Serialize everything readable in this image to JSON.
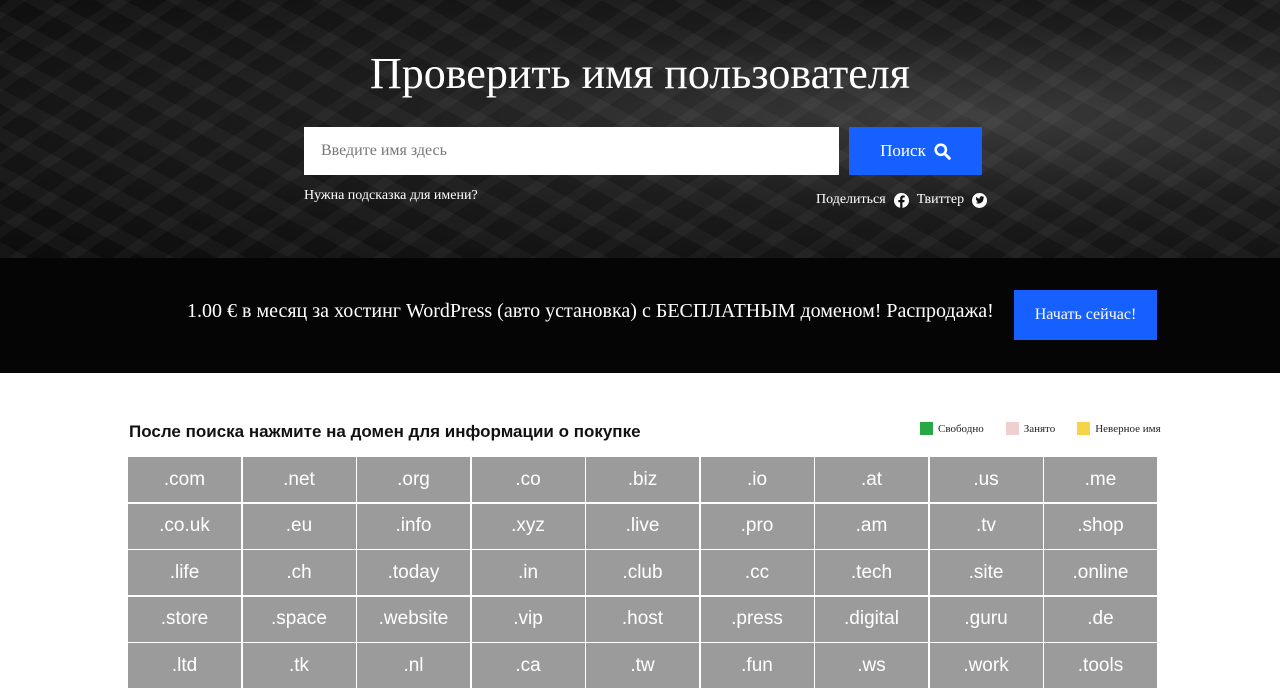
{
  "hero": {
    "title": "Проверить имя пользователя",
    "search_placeholder": "Введите имя здесь",
    "search_button": "Поиск",
    "hint_link": "Нужна подсказка для имени?",
    "share_label": "Поделиться",
    "twitter_label": "Твиттер"
  },
  "promo": {
    "text": "1.00 € в месяц за хостинг WordPress (авто установка) с БЕСПЛАТНЫМ доменом! Распродажа!",
    "button": "Начать сейчас!"
  },
  "results": {
    "heading": "После поиска нажмите на домен для информации о покупке",
    "legend": [
      {
        "label": "Свободно",
        "color": "#28a745"
      },
      {
        "label": "Занято",
        "color": "#efcfcf"
      },
      {
        "label": "Неверное имя",
        "color": "#f5d547"
      }
    ],
    "domains": [
      ".com",
      ".net",
      ".org",
      ".co",
      ".biz",
      ".io",
      ".at",
      ".us",
      ".me",
      ".co.uk",
      ".eu",
      ".info",
      ".xyz",
      ".live",
      ".pro",
      ".am",
      ".tv",
      ".shop",
      ".life",
      ".ch",
      ".today",
      ".in",
      ".club",
      ".cc",
      ".tech",
      ".site",
      ".online",
      ".store",
      ".space",
      ".website",
      ".vip",
      ".host",
      ".press",
      ".digital",
      ".guru",
      ".de",
      ".ltd",
      ".tk",
      ".nl",
      ".ca",
      ".tw",
      ".fun",
      ".ws",
      ".work",
      ".tools"
    ]
  },
  "colors": {
    "accent": "#1560ff",
    "domain_cell": "#9b9b9b"
  }
}
